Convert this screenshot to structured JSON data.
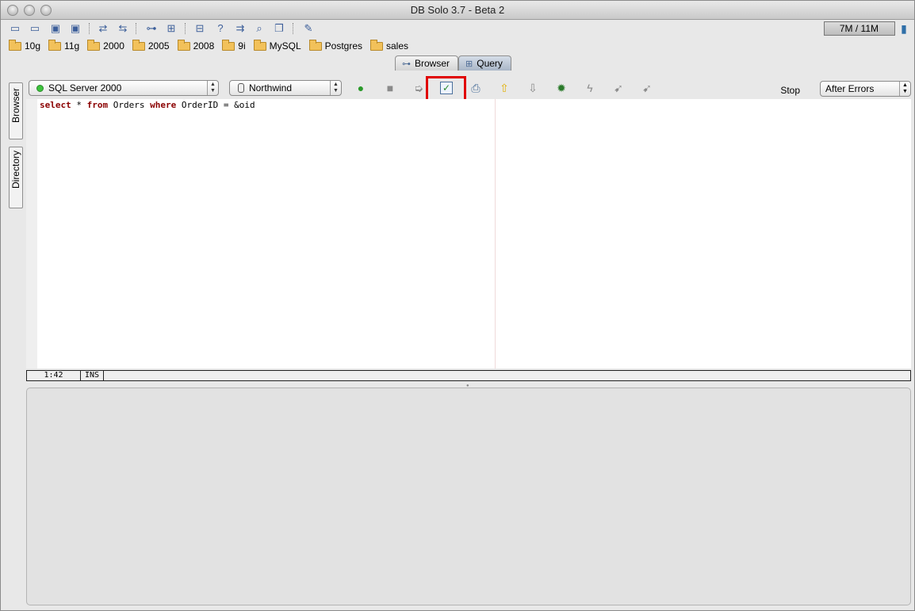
{
  "window": {
    "title": "DB Solo  3.7 - Beta 2"
  },
  "memory": {
    "label": "7M / 11M"
  },
  "bookmarks": [
    "10g",
    "11g",
    "2000",
    "2005",
    "2008",
    "9i",
    "MySQL",
    "Postgres",
    "sales"
  ],
  "tabs": [
    {
      "label": "Browser",
      "active": false
    },
    {
      "label": "Query",
      "active": true
    }
  ],
  "side_tabs": [
    "Browser",
    "Directory"
  ],
  "query": {
    "connection": "SQL Server 2000",
    "database": "Northwind",
    "stop_label": "Stop",
    "stop_mode": "After Errors",
    "sql": {
      "kw_select": "select",
      "part1": " * ",
      "kw_from": "from",
      "part2": " Orders ",
      "kw_where": "where",
      "part3": " OrderID = &oid"
    },
    "status": {
      "position": "1:42",
      "mode": "INS"
    }
  },
  "icons": {
    "toolbar": [
      "open-folder-icon",
      "open-recent-icon",
      "save-icon",
      "save-all-icon",
      "connect-icon",
      "disconnect-icon",
      "tree-icon",
      "grid-icon",
      "schema-icon",
      "help-query-icon",
      "compare-icon",
      "search-icon",
      "copy-icon",
      "edit-icon"
    ],
    "query_buttons": [
      "run-icon",
      "stop-icon",
      "export-icon",
      "commit-icon",
      "print-icon",
      "up-arrow-icon",
      "down-arrow-icon",
      "debug-icon",
      "flash-icon",
      "step-icon",
      "step-over-icon"
    ]
  }
}
